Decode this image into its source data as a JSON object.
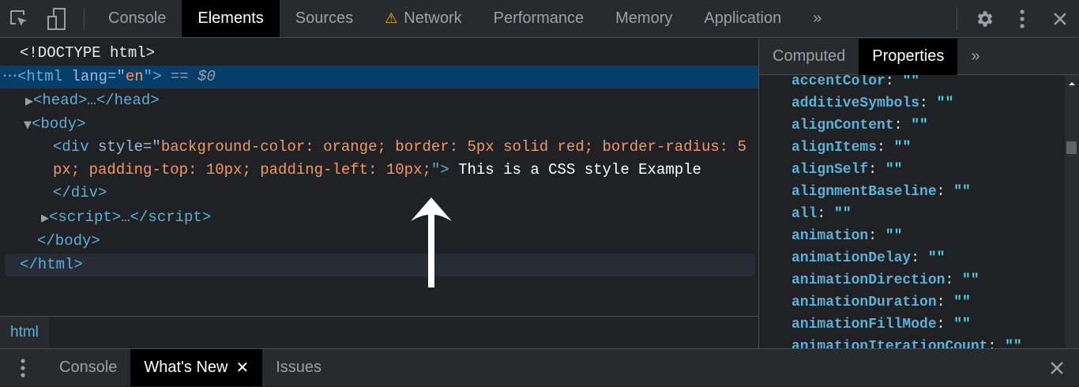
{
  "toolbar": {
    "tabs": [
      {
        "label": "Console"
      },
      {
        "label": "Elements",
        "active": true
      },
      {
        "label": "Sources"
      },
      {
        "label": "Network",
        "warning": true
      },
      {
        "label": "Performance"
      },
      {
        "label": "Memory"
      },
      {
        "label": "Application"
      }
    ],
    "more": "»",
    "icons": [
      "inspect-icon",
      "device-toolbar-icon",
      "gear-icon",
      "kebab-menu-icon",
      "close-icon"
    ]
  },
  "dom": {
    "doctype": "<!DOCTYPE html>",
    "html_open": "<html",
    "html_attr": " lang",
    "html_eq": "=\"",
    "html_val": "en",
    "html_close": "\">",
    "selected_marker": " == $0",
    "head": "<head>…</head>",
    "body_open": "<body>",
    "div_open": "<div",
    "div_attr": " style",
    "div_eq": "=\"",
    "div_val1": "background-color: orange; border: 5px solid red; border-radius: 5",
    "div_val2": "px; padding-top: 10px; padding-left: 10px;",
    "div_close": "\">",
    "div_text": " This is a CSS style Example",
    "div_end": "</div>",
    "script": "<script>…</script>",
    "body_end": "</body>",
    "html_end": "</html>"
  },
  "breadcrumb": "html",
  "side": {
    "tabs": [
      {
        "label": "Computed"
      },
      {
        "label": "Properties",
        "active": true
      }
    ],
    "more": "»",
    "properties": [
      {
        "name": "accentColor",
        "value": "\"\""
      },
      {
        "name": "additiveSymbols",
        "value": "\"\""
      },
      {
        "name": "alignContent",
        "value": "\"\""
      },
      {
        "name": "alignItems",
        "value": "\"\""
      },
      {
        "name": "alignSelf",
        "value": "\"\""
      },
      {
        "name": "alignmentBaseline",
        "value": "\"\""
      },
      {
        "name": "all",
        "value": "\"\""
      },
      {
        "name": "animation",
        "value": "\"\""
      },
      {
        "name": "animationDelay",
        "value": "\"\""
      },
      {
        "name": "animationDirection",
        "value": "\"\""
      },
      {
        "name": "animationDuration",
        "value": "\"\""
      },
      {
        "name": "animationFillMode",
        "value": "\"\""
      },
      {
        "name": "animationIterationCount",
        "value": "\"\""
      }
    ]
  },
  "drawer": {
    "tabs": [
      {
        "label": "Console"
      },
      {
        "label": "What's New",
        "active": true,
        "closable": true
      },
      {
        "label": "Issues"
      }
    ]
  },
  "colors": {
    "tag": "#5db0d7",
    "attr_name": "#9bbbdc",
    "attr_value": "#f29766",
    "selection": "#073d69",
    "warning": "#f5b400"
  }
}
